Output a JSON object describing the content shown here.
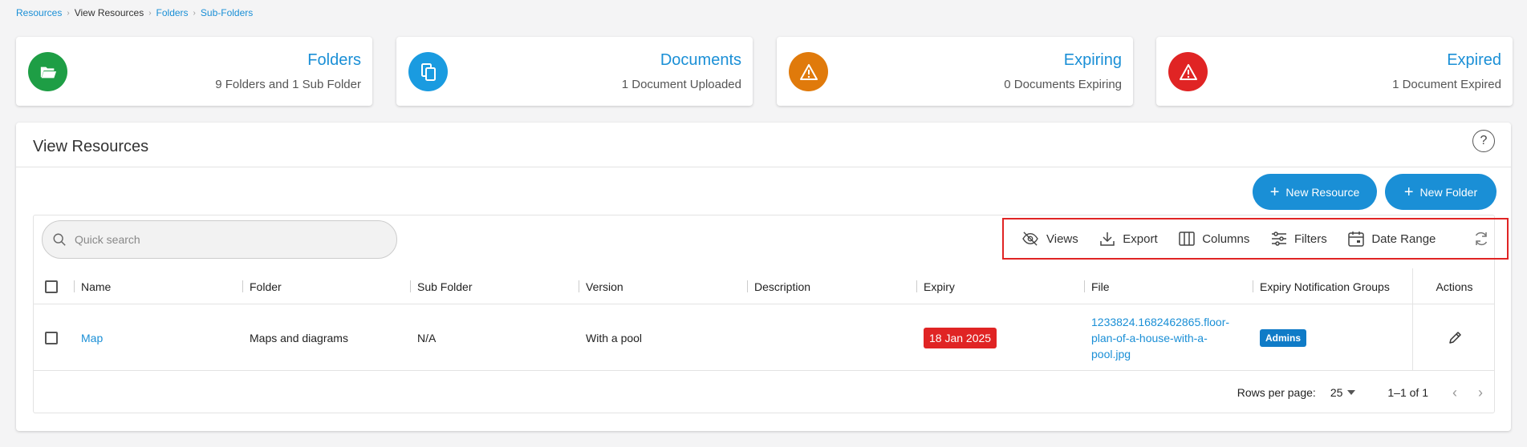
{
  "breadcrumb": {
    "items": [
      "Resources",
      "View Resources",
      "Folders",
      "Sub-Folders"
    ]
  },
  "cards": [
    {
      "title": "Folders",
      "subtitle": "9 Folders and 1 Sub Folder",
      "icon": "folder-open-icon",
      "color": "#1e9e45"
    },
    {
      "title": "Documents",
      "subtitle": "1 Document Uploaded",
      "icon": "documents-icon",
      "color": "#1a9be0"
    },
    {
      "title": "Expiring",
      "subtitle": "0 Documents Expiring",
      "icon": "warning-icon",
      "color": "#e07a0b"
    },
    {
      "title": "Expired",
      "subtitle": "1 Document Expired",
      "icon": "warning-icon",
      "color": "#e02424"
    }
  ],
  "panel": {
    "title": "View Resources",
    "help": "?",
    "new_resource_label": "New Resource",
    "new_folder_label": "New Folder"
  },
  "search": {
    "placeholder": "Quick search"
  },
  "toolbar": {
    "views": "Views",
    "export": "Export",
    "columns": "Columns",
    "filters": "Filters",
    "date_range": "Date Range"
  },
  "table": {
    "columns": [
      "Name",
      "Folder",
      "Sub Folder",
      "Version",
      "Description",
      "Expiry",
      "File",
      "Expiry Notification Groups",
      "Actions"
    ],
    "rows": [
      {
        "name": "Map",
        "folder": "Maps and diagrams",
        "sub_folder": "N/A",
        "version": "With a pool",
        "description": "",
        "expiry": "18 Jan 2025",
        "file_line1": "1233824.1682462865.floor-",
        "file_line2": "plan-of-a-house-with-a-",
        "file_line3": "pool.jpg",
        "group": "Admins"
      }
    ]
  },
  "footer": {
    "rows_per_page_label": "Rows per page:",
    "rows_per_page_value": "25",
    "range": "1–1 of 1"
  }
}
